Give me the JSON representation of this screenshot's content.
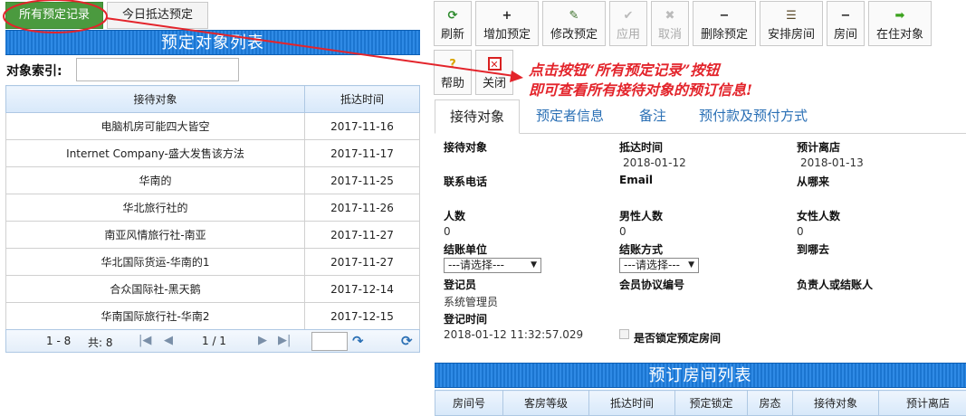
{
  "left": {
    "tab_all": "所有预定记录",
    "tab_today": "今日抵达预定",
    "banner": "预定对象列表",
    "search_label": "对象索引:",
    "columns": [
      "接待对象",
      "抵达时间"
    ],
    "rows": [
      [
        "电脑机房可能四大皆空",
        "2017-11-16"
      ],
      [
        "Internet Company-盛大发售该方法",
        "2017-11-17"
      ],
      [
        "华南的",
        "2017-11-25"
      ],
      [
        "华北旅行社的",
        "2017-11-26"
      ],
      [
        "南亚风情旅行社-南亚",
        "2017-11-27"
      ],
      [
        "华北国际货运-华南的1",
        "2017-11-27"
      ],
      [
        "合众国际社-黑天鹅",
        "2017-12-14"
      ],
      [
        "华南国际旅行社-华南2",
        "2017-12-15"
      ]
    ],
    "pager": {
      "range": "1 - 8",
      "total": "共: 8",
      "page": "1 / 1"
    }
  },
  "toolbar": {
    "refresh": "刷新",
    "add": "增加预定",
    "edit": "修改预定",
    "apply": "应用",
    "cancel": "取消",
    "delete": "删除预定",
    "arrange": "安排房间",
    "room": "房间",
    "in_house": "在住对象",
    "help": "帮助",
    "close": "关闭"
  },
  "annotation": {
    "line1": "点击按钮“所有预定记录”按钮",
    "line2": "即可查看所有接待对象的预订信息!"
  },
  "detail_tabs": [
    "接待对象",
    "预定者信息",
    "备注",
    "预付款及预付方式"
  ],
  "form": {
    "guest_label": "接待对象",
    "arrival_label": "抵达时间",
    "arrival_value": "2018-01-12",
    "departure_label": "预计离店",
    "departure_value": "2018-01-13",
    "phone_label": "联系电话",
    "email_label": "Email",
    "from_label": "从哪来",
    "people_label": "人数",
    "people_value": "0",
    "male_label": "男性人数",
    "male_value": "0",
    "female_label": "女性人数",
    "female_value": "0",
    "billing_unit_label": "结账单位",
    "billing_unit_value": "---请选择---",
    "billing_method_label": "结账方式",
    "billing_method_value": "---请选择---",
    "to_label": "到哪去",
    "registrar_label": "登记员",
    "registrar_value": "系统管理员",
    "member_label": "会员协议编号",
    "responsible_label": "负责人或结账人",
    "regtime_label": "登记时间",
    "regtime_value": "2018-01-12 11:32:57.029",
    "lock_label": "是否锁定预定房间"
  },
  "rooms": {
    "banner": "预订房间列表",
    "columns": [
      "房间号",
      "客房等级",
      "抵达时间",
      "预定锁定",
      "房态",
      "接待对象",
      "预计离店"
    ]
  },
  "colors": {
    "accent_green": "#4b9a3f",
    "banner_blue": "#1b75d0",
    "annotation_red": "#e3242b"
  }
}
